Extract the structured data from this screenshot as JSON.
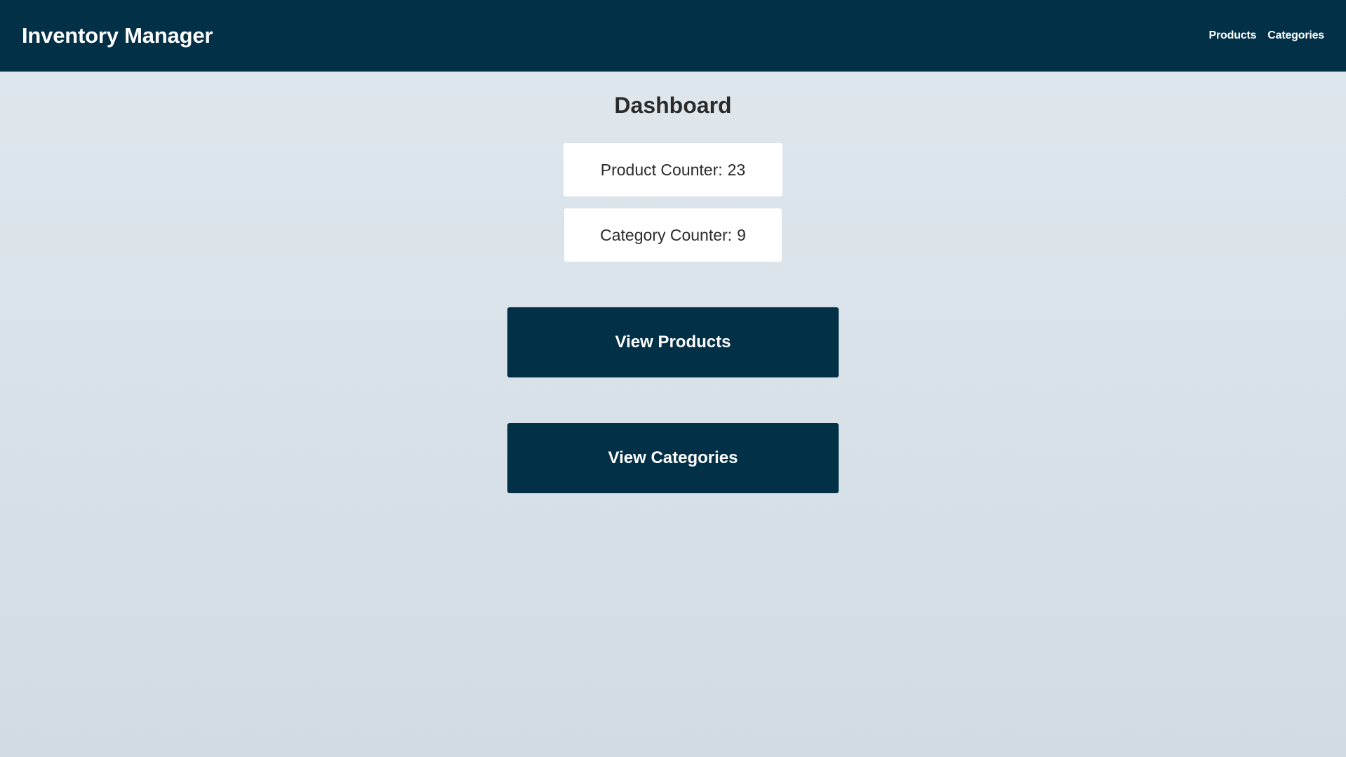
{
  "app": {
    "title": "Inventory Manager"
  },
  "nav": {
    "items": [
      {
        "label": "Products"
      },
      {
        "label": "Categories"
      }
    ]
  },
  "main": {
    "title": "Dashboard",
    "counters": {
      "products": {
        "label": "Product Counter:",
        "value": "23"
      },
      "categories": {
        "label": "Category Counter:",
        "value": "9"
      }
    },
    "buttons": {
      "view_products": "View Products",
      "view_categories": "View Categories"
    }
  },
  "colors": {
    "primary": "#023047",
    "background_top": "#e0e8ee",
    "background_bottom": "#d2dbe3",
    "card": "#ffffff",
    "text": "#2b2b2b"
  }
}
